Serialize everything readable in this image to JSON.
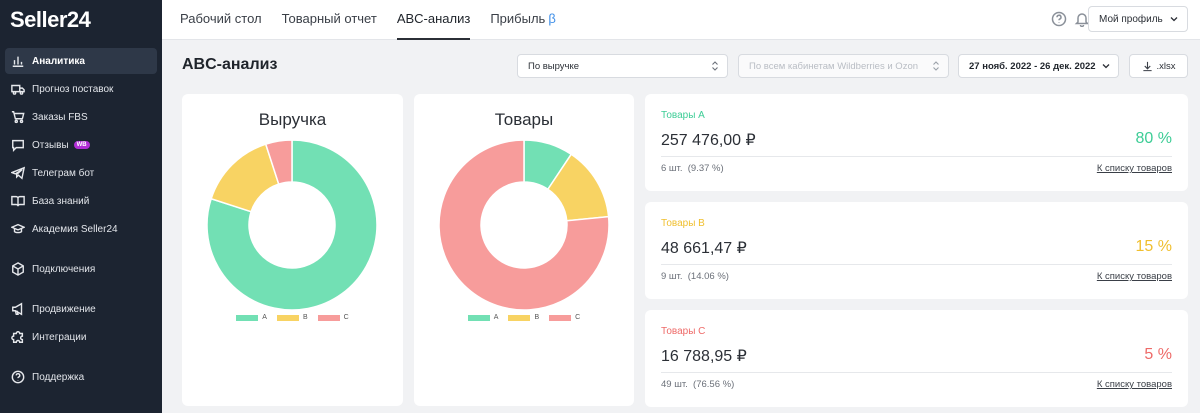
{
  "app": {
    "logo": "Seller24"
  },
  "sidebar": {
    "items": [
      {
        "label": "Аналитика",
        "icon": "bar-chart-icon",
        "active": true
      },
      {
        "label": "Прогноз поставок",
        "icon": "truck-icon"
      },
      {
        "label": "Заказы FBS",
        "icon": "cart-icon"
      },
      {
        "label": "Отзывы",
        "icon": "chat-icon",
        "badge": "WB"
      },
      {
        "label": "Телеграм бот",
        "icon": "telegram-icon"
      },
      {
        "label": "База знаний",
        "icon": "book-icon"
      },
      {
        "label": "Академия Seller24",
        "icon": "graduation-icon"
      },
      {
        "label": "Подключения",
        "icon": "cube-icon"
      },
      {
        "label": "Продвижение",
        "icon": "megaphone-icon"
      },
      {
        "label": "Интеграции",
        "icon": "puzzle-icon"
      },
      {
        "label": "Поддержка",
        "icon": "help-icon"
      }
    ]
  },
  "header": {
    "tabs": [
      {
        "label": "Рабочий стол"
      },
      {
        "label": "Товарный отчет"
      },
      {
        "label": "ABC-анализ",
        "active": true
      },
      {
        "label": "Прибыль",
        "suffix": "β"
      }
    ],
    "profile_label": "Мой профиль"
  },
  "main": {
    "title": "ABC-анализ",
    "metric_select": "По выручке",
    "cabinet_select": "По всем кабинетам Wildberries и Ozon",
    "date_range": "27 нояб. 2022 - 26 дек. 2022",
    "export_label": ".xlsx"
  },
  "colors": {
    "A": "#72e0b4",
    "B": "#f8d363",
    "C": "#f79c9b",
    "A_text": "#3dcd96",
    "B_text": "#f0bf2e",
    "C_text": "#ee6a68"
  },
  "chart_data": [
    {
      "type": "pie",
      "title": "Выручка",
      "categories": [
        "A",
        "B",
        "C"
      ],
      "values": [
        80,
        15,
        5
      ],
      "legend": "bottom"
    },
    {
      "type": "pie",
      "title": "Товары",
      "categories": [
        "A",
        "B",
        "C"
      ],
      "values": [
        9.37,
        14.06,
        76.56
      ],
      "legend": "bottom"
    }
  ],
  "groups": [
    {
      "label": "Товары A",
      "value": "257 476,00 ₽",
      "percent": "80 %",
      "count": "6 шт.",
      "share": "(9.37 %)",
      "link": "К списку товаров"
    },
    {
      "label": "Товары B",
      "value": "48 661,47 ₽",
      "percent": "15 %",
      "count": "9 шт.",
      "share": "(14.06 %)",
      "link": "К списку товаров"
    },
    {
      "label": "Товары C",
      "value": "16 788,95 ₽",
      "percent": "5 %",
      "count": "49 шт.",
      "share": "(76.56 %)",
      "link": "К списку товаров"
    }
  ]
}
